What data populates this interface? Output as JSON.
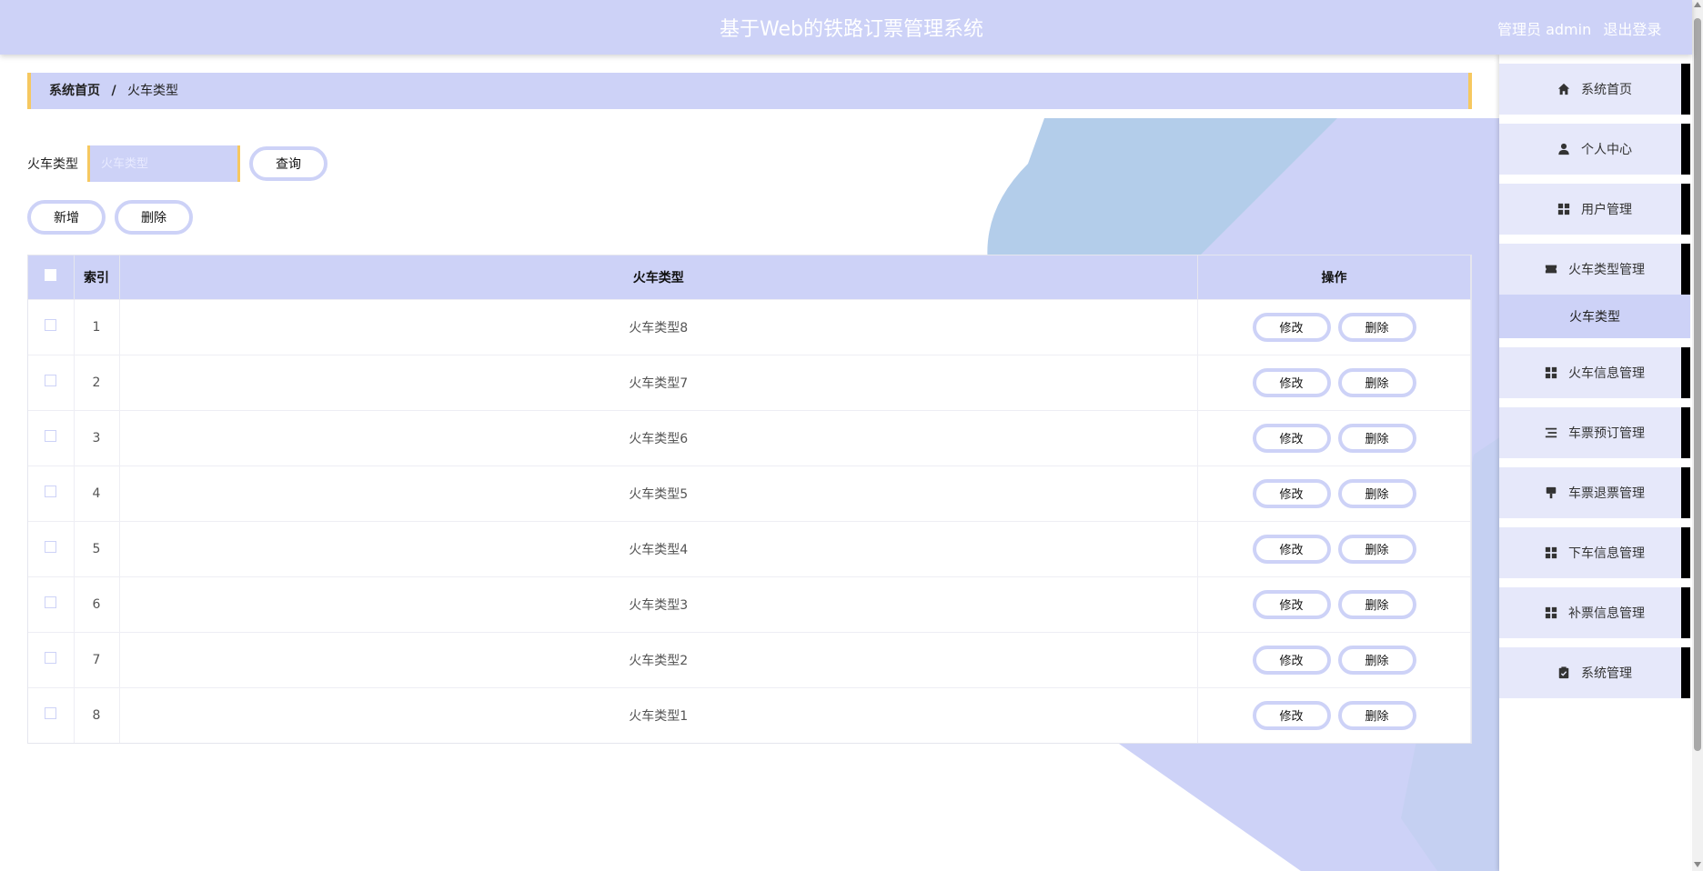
{
  "header": {
    "title": "基于Web的铁路订票管理系统",
    "user": "管理员 admin",
    "logout": "退出登录"
  },
  "breadcrumb": {
    "home": "系统首页",
    "separator": "/",
    "current": "火车类型"
  },
  "search": {
    "label": "火车类型",
    "placeholder": "火车类型",
    "button": "查询"
  },
  "actions": {
    "add": "新增",
    "delete": "删除"
  },
  "table": {
    "columns": [
      "索引",
      "火车类型",
      "操作"
    ],
    "rows": [
      {
        "index": "1",
        "type": "火车类型8"
      },
      {
        "index": "2",
        "type": "火车类型7"
      },
      {
        "index": "3",
        "type": "火车类型6"
      },
      {
        "index": "4",
        "type": "火车类型5"
      },
      {
        "index": "5",
        "type": "火车类型4"
      },
      {
        "index": "6",
        "type": "火车类型3"
      },
      {
        "index": "7",
        "type": "火车类型2"
      },
      {
        "index": "8",
        "type": "火车类型1"
      }
    ],
    "edit_label": "修改",
    "delete_label": "删除"
  },
  "sidebar": {
    "items": [
      {
        "label": "系统首页",
        "icon": "home-icon"
      },
      {
        "label": "个人中心",
        "icon": "user-icon"
      },
      {
        "label": "用户管理",
        "icon": "grid-icon"
      },
      {
        "label": "火车类型管理",
        "icon": "ticket-icon"
      },
      {
        "label": "火车信息管理",
        "icon": "grid-icon"
      },
      {
        "label": "车票预订管理",
        "icon": "list-icon"
      },
      {
        "label": "车票退票管理",
        "icon": "brush-icon"
      },
      {
        "label": "下车信息管理",
        "icon": "grid-icon"
      },
      {
        "label": "补票信息管理",
        "icon": "grid-icon"
      },
      {
        "label": "系统管理",
        "icon": "clipboard-icon"
      }
    ],
    "active_sub": "火车类型"
  },
  "colors": {
    "primary": "#cdd2f7",
    "accent": "#f6c860",
    "bg_shape_blue": "#b3cdea",
    "bg_shape_lavender": "#cdd2f7"
  }
}
